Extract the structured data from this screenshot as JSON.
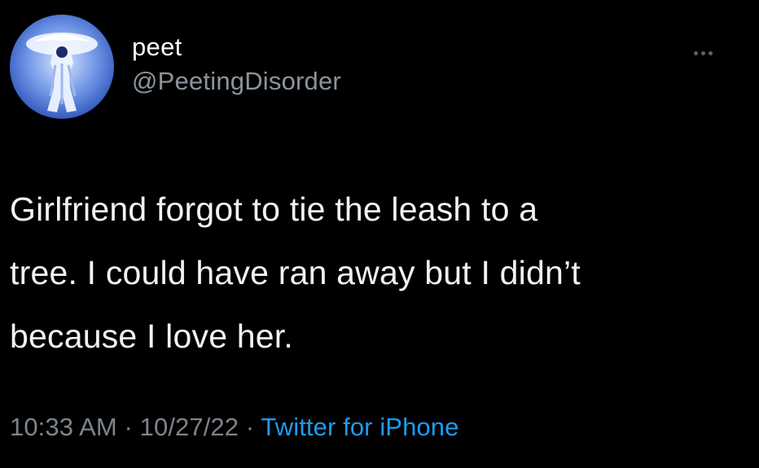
{
  "tweet": {
    "display_name": "peet",
    "handle": "@PeetingDisorder",
    "text_line_1": "Girlfriend forgot to tie the leash to a",
    "text_line_2": "tree. I could have ran away but I didn’t",
    "text_line_3": "because I love her.",
    "time": "10:33 AM",
    "separator": " · ",
    "date": "10/27/22",
    "source": "Twitter for iPhone",
    "more_icon": "more-horizontal-icon"
  },
  "colors": {
    "background": "#000000",
    "text": "#f2f2f2",
    "secondary": "#7d848b",
    "link": "#1d9bf0"
  }
}
